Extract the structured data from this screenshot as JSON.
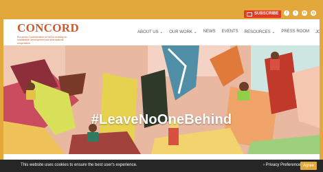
{
  "topbar": {
    "subscribe_label": "SUBSCRIBE",
    "social": [
      "f",
      "t",
      "in",
      "ig",
      "rss",
      "yt"
    ]
  },
  "logo": {
    "name": "CONCORD",
    "subtitle": "European Confederation of NGOs working on sustainable development and international cooperation"
  },
  "nav": {
    "items": [
      "ABOUT US ⌄",
      "OUR WORK ⌄",
      "NEWS",
      "EVENTS",
      "RESOURCES ⌄",
      "PRESS ROOM",
      "JOIN US ⌄"
    ],
    "search_icon": "search-icon"
  },
  "hero": {
    "hashtag": "#LeaveNoOneBehind"
  },
  "cookie": {
    "message": "This website uses cookies to ensure the best user's experience.",
    "privacy_link": "› Privacy Preferences",
    "agree_label": "Agree"
  },
  "colors": {
    "accent": "#e3a83c",
    "subscribe": "#e23a26",
    "brand": "#c95a2b"
  }
}
